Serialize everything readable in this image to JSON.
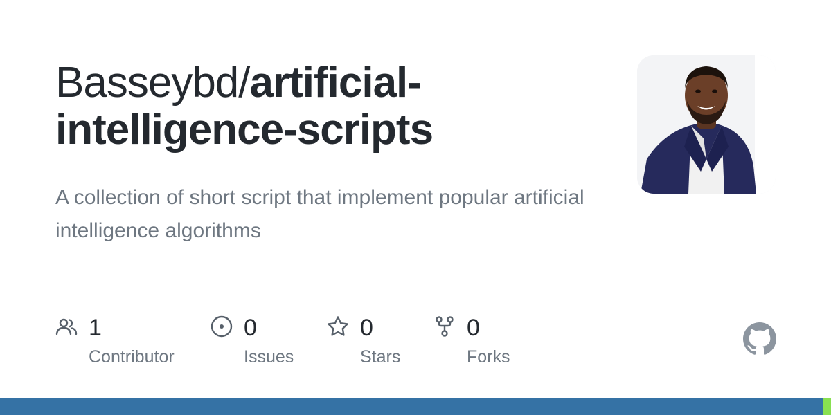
{
  "repo": {
    "owner": "Basseybd/",
    "name": "artificial-intelligence-scripts",
    "description": "A collection of short script that implement popular artificial intelligence algorithms"
  },
  "stats": [
    {
      "icon": "people-icon",
      "count": "1",
      "label": "Contributor"
    },
    {
      "icon": "issue-opened-icon",
      "count": "0",
      "label": "Issues"
    },
    {
      "icon": "star-icon",
      "count": "0",
      "label": "Stars"
    },
    {
      "icon": "repo-forked-icon",
      "count": "0",
      "label": "Forks"
    }
  ],
  "colors": {
    "title": "#24292f",
    "muted": "#6e7781",
    "icon": "#57606a",
    "github_mark": "#8c959f"
  },
  "languages": [
    {
      "color": "#3572A5",
      "share": 0.99
    },
    {
      "color": "#89e051",
      "share": 0.01
    }
  ]
}
